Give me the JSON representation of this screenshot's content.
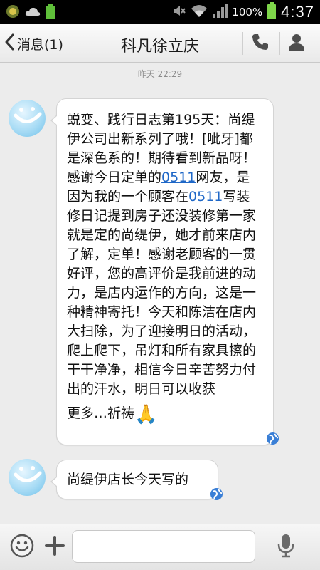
{
  "status_bar": {
    "battery_percent": "100%",
    "time": "4:37",
    "icons": [
      "weather-sun-icon",
      "cloud-icon",
      "battery-small-icon",
      "mute-icon",
      "wifi-icon",
      "signal-icon",
      "battery-icon"
    ]
  },
  "header": {
    "back_label": "消息(1)",
    "title": "科凡徐立庆"
  },
  "chat": {
    "timestamp": "昨天 22:29",
    "messages": [
      {
        "text_a": "蜕变、践行日志第195天：尚缇伊公司出新系列了哦！[呲牙]都是深色系的！期待看到新品呀！感谢今日定单的",
        "link_1": "0511",
        "text_b": "网友，是因为我的一个顾客在",
        "link_2": "0511",
        "text_c": "写装修日记提到房子还没装修第一家就是定的尚缇伊，她才前来店内了解，定单！感谢老顾客的一贯好评，您的高评价是我前进的动力，是店内运作的方向，这是一种精神寄托！今天和陈洁在店内大扫除，为了迎接明日的活动，爬上爬下，吊灯和所有家具擦的干干净净，相信今日辛苦努力付出的汗水，明日可以收获",
        "text_d": "更多…祈祷",
        "emoji": "🙏"
      },
      {
        "text": "尚缇伊店长今天写的"
      }
    ]
  },
  "colors": {
    "link": "#1e67c7",
    "bubble": "#ffffff",
    "background": "#ececec"
  }
}
